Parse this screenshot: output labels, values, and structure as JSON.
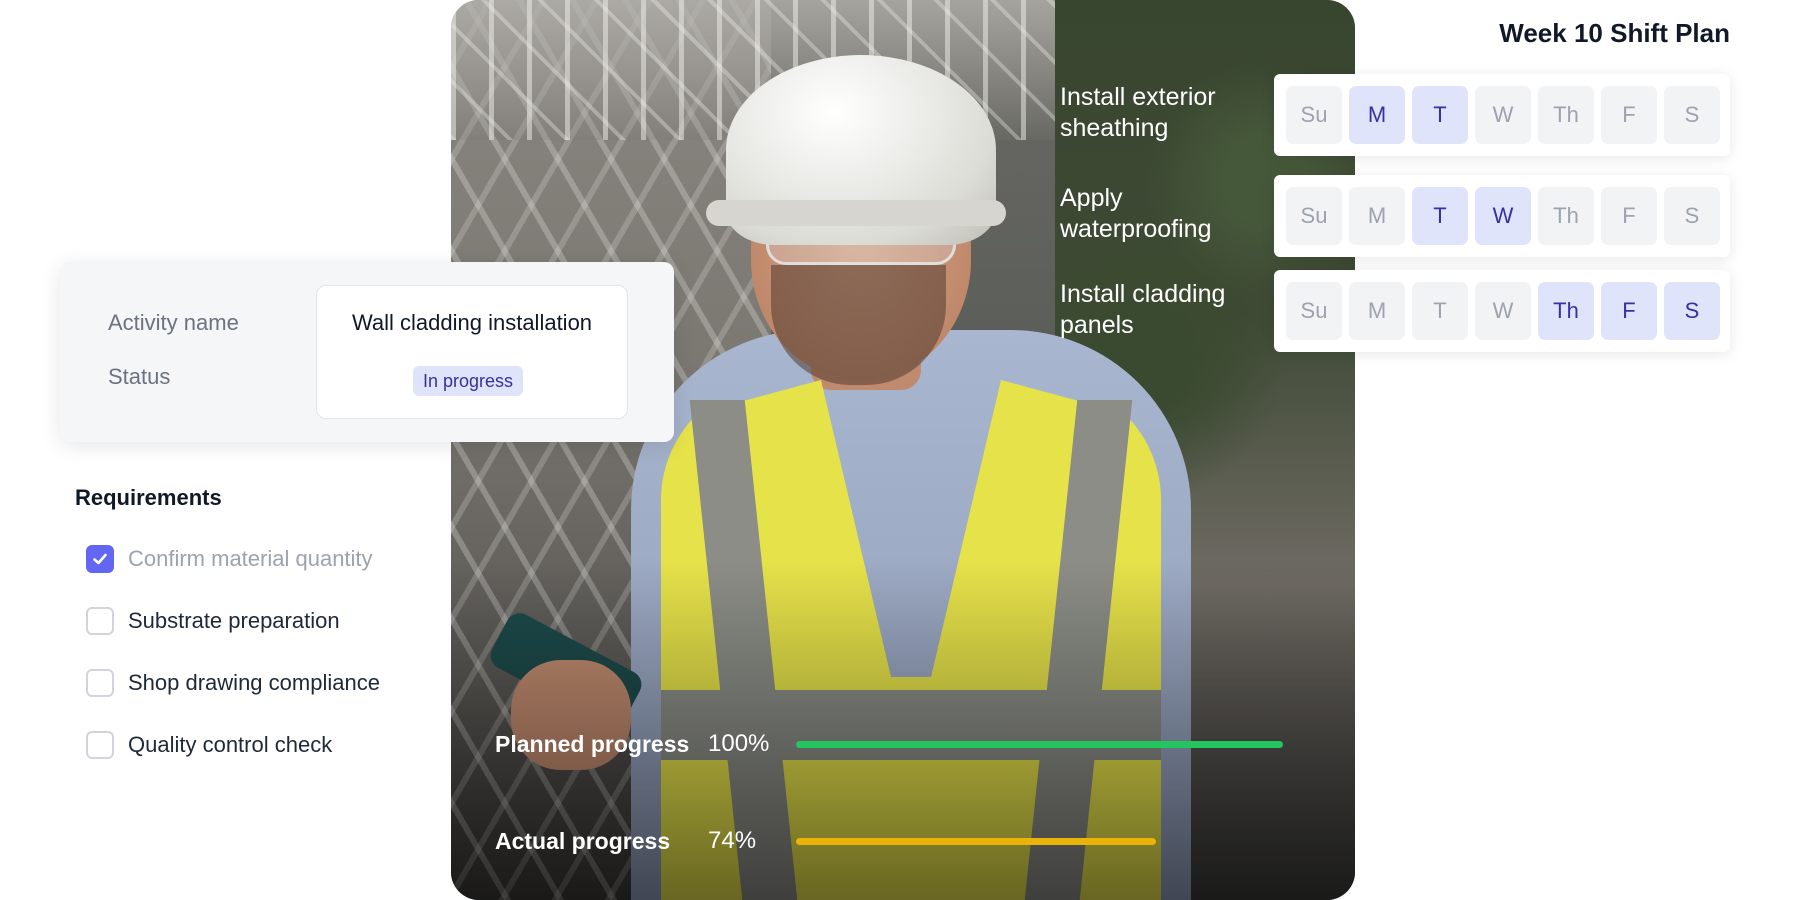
{
  "shift_plan": {
    "title": "Week 10 Shift Plan",
    "tasks": [
      {
        "name": "Install exterior sheathing",
        "days": [
          {
            "label": "Su",
            "active": false
          },
          {
            "label": "M",
            "active": true
          },
          {
            "label": "T",
            "active": true
          },
          {
            "label": "W",
            "active": false
          },
          {
            "label": "Th",
            "active": false
          },
          {
            "label": "F",
            "active": false
          },
          {
            "label": "S",
            "active": false
          }
        ]
      },
      {
        "name": "Apply waterproofing",
        "days": [
          {
            "label": "Su",
            "active": false
          },
          {
            "label": "M",
            "active": false
          },
          {
            "label": "T",
            "active": true
          },
          {
            "label": "W",
            "active": true
          },
          {
            "label": "Th",
            "active": false
          },
          {
            "label": "F",
            "active": false
          },
          {
            "label": "S",
            "active": false
          }
        ]
      },
      {
        "name": "Install cladding panels",
        "days": [
          {
            "label": "Su",
            "active": false
          },
          {
            "label": "M",
            "active": false
          },
          {
            "label": "T",
            "active": false
          },
          {
            "label": "W",
            "active": false
          },
          {
            "label": "Th",
            "active": true
          },
          {
            "label": "F",
            "active": true
          },
          {
            "label": "S",
            "active": true
          }
        ]
      }
    ]
  },
  "activity": {
    "name_label": "Activity name",
    "name_value": "Wall cladding installation",
    "status_label": "Status",
    "status_value": "In progress"
  },
  "requirements": {
    "title": "Requirements",
    "items": [
      {
        "label": "Confirm material quantity",
        "checked": true
      },
      {
        "label": "Substrate preparation",
        "checked": false
      },
      {
        "label": "Shop drawing compliance",
        "checked": false
      },
      {
        "label": "Quality control check",
        "checked": false
      }
    ]
  },
  "progress": {
    "planned": {
      "label": "Planned progress",
      "value_text": "100%",
      "fraction": 1.0,
      "color": "#22c55e"
    },
    "actual": {
      "label": "Actual progress",
      "value_text": "74%",
      "fraction": 0.74,
      "color": "#eab308"
    }
  },
  "colors": {
    "accent": "#6366f1",
    "active_day_bg": "#e0e4fb",
    "active_day_text": "#3730a3"
  }
}
